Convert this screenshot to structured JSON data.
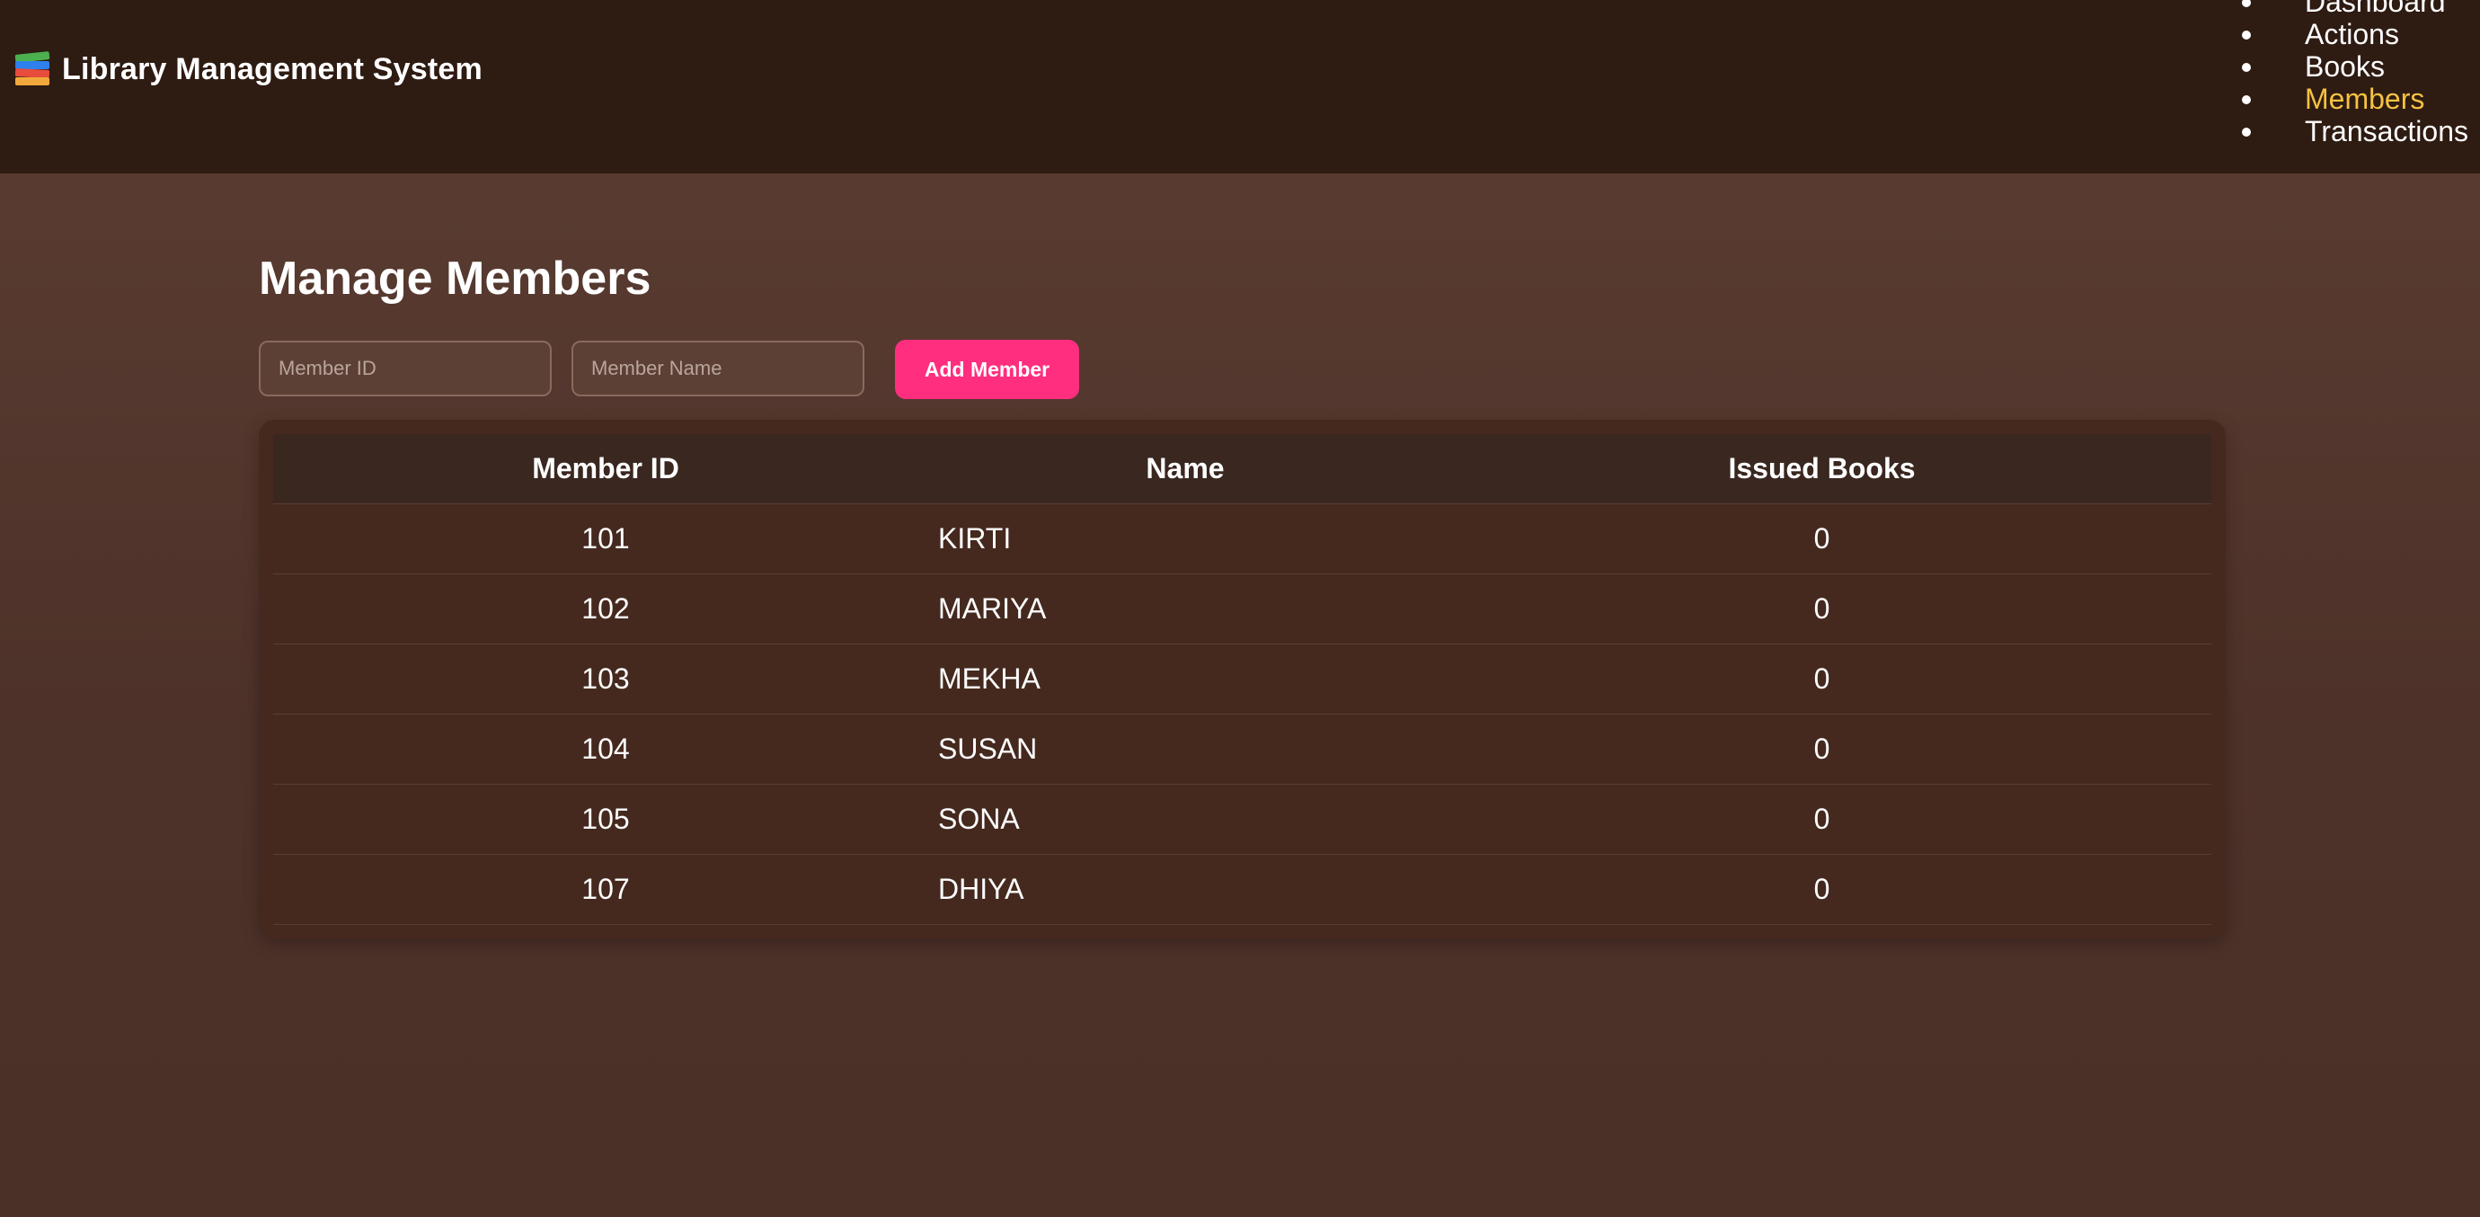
{
  "header": {
    "title": "Library Management System",
    "logo_icon": "books-icon",
    "nav": [
      {
        "label": "Dashboard",
        "active": false
      },
      {
        "label": "Actions",
        "active": false
      },
      {
        "label": "Books",
        "active": false
      },
      {
        "label": "Members",
        "active": true
      },
      {
        "label": "Transactions",
        "active": false
      }
    ]
  },
  "main": {
    "title": "Manage Members",
    "form": {
      "member_id": {
        "value": "",
        "placeholder": "Member ID"
      },
      "member_name": {
        "value": "",
        "placeholder": "Member Name"
      },
      "add_label": "Add Member"
    },
    "table": {
      "columns": [
        "Member ID",
        "Name",
        "Issued Books"
      ],
      "rows": [
        {
          "id": "101",
          "name": "KIRTI",
          "issued": "0"
        },
        {
          "id": "102",
          "name": "MARIYA",
          "issued": "0"
        },
        {
          "id": "103",
          "name": "MEKHA",
          "issued": "0"
        },
        {
          "id": "104",
          "name": "SUSAN",
          "issued": "0"
        },
        {
          "id": "105",
          "name": "SONA",
          "issued": "0"
        },
        {
          "id": "107",
          "name": "DHIYA",
          "issued": "0"
        }
      ]
    }
  },
  "colors": {
    "header_bg": "#2e1b12",
    "page_bg": "#5c3d33",
    "accent_button": "#ff2e7e",
    "active_nav": "#f5c242"
  }
}
